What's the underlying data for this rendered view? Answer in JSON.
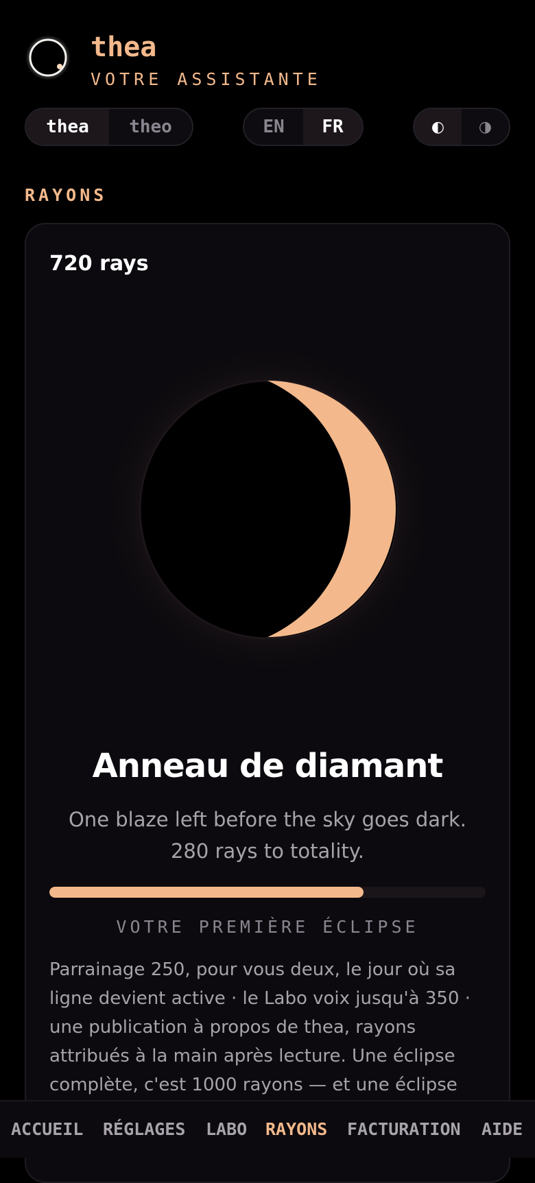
{
  "header": {
    "brand_name": "thea",
    "brand_subtitle": "VOTRE ASSISTANTE"
  },
  "persona_toggle": {
    "options": [
      "thea",
      "theo"
    ],
    "selected": "thea"
  },
  "language_toggle": {
    "options": [
      "EN",
      "FR"
    ],
    "selected": "FR"
  },
  "theme_toggle": {
    "options": [
      "◐",
      "◑"
    ],
    "selected": "◐"
  },
  "section": {
    "label": "RAYONS"
  },
  "card": {
    "rays_count": "720 rays",
    "stage_title": "Anneau de diamant",
    "stage_description": "One blaze left before the sky goes dark. 280 rays to totality.",
    "progress_fraction": 0.72,
    "first_eclipse_label": "VOTRE PREMIÈRE ÉCLIPSE",
    "bonus_text": "Parrainage 250, pour vous deux, le jour où sa ligne devient active · le Labo voix jusqu'à 350 · une publication à propos de thea, rayons attribués à la main après lecture. Une éclipse complète, c'est 1000 rayons — et une éclipse complète, c'est un"
  },
  "bottom_nav": {
    "items": [
      "ACCUEIL",
      "RÉGLAGES",
      "LABO",
      "RAYONS",
      "FACTURATION",
      "AIDE"
    ],
    "active": "RAYONS"
  },
  "colors": {
    "accent": "#f3b98c",
    "background": "#000000",
    "card": "#0c0a0e",
    "muted_text": "#a8a3ab"
  },
  "icons": {
    "logo": "eclipse-ring-icon",
    "eclipse_visual": "crescent-eclipse-icon"
  }
}
